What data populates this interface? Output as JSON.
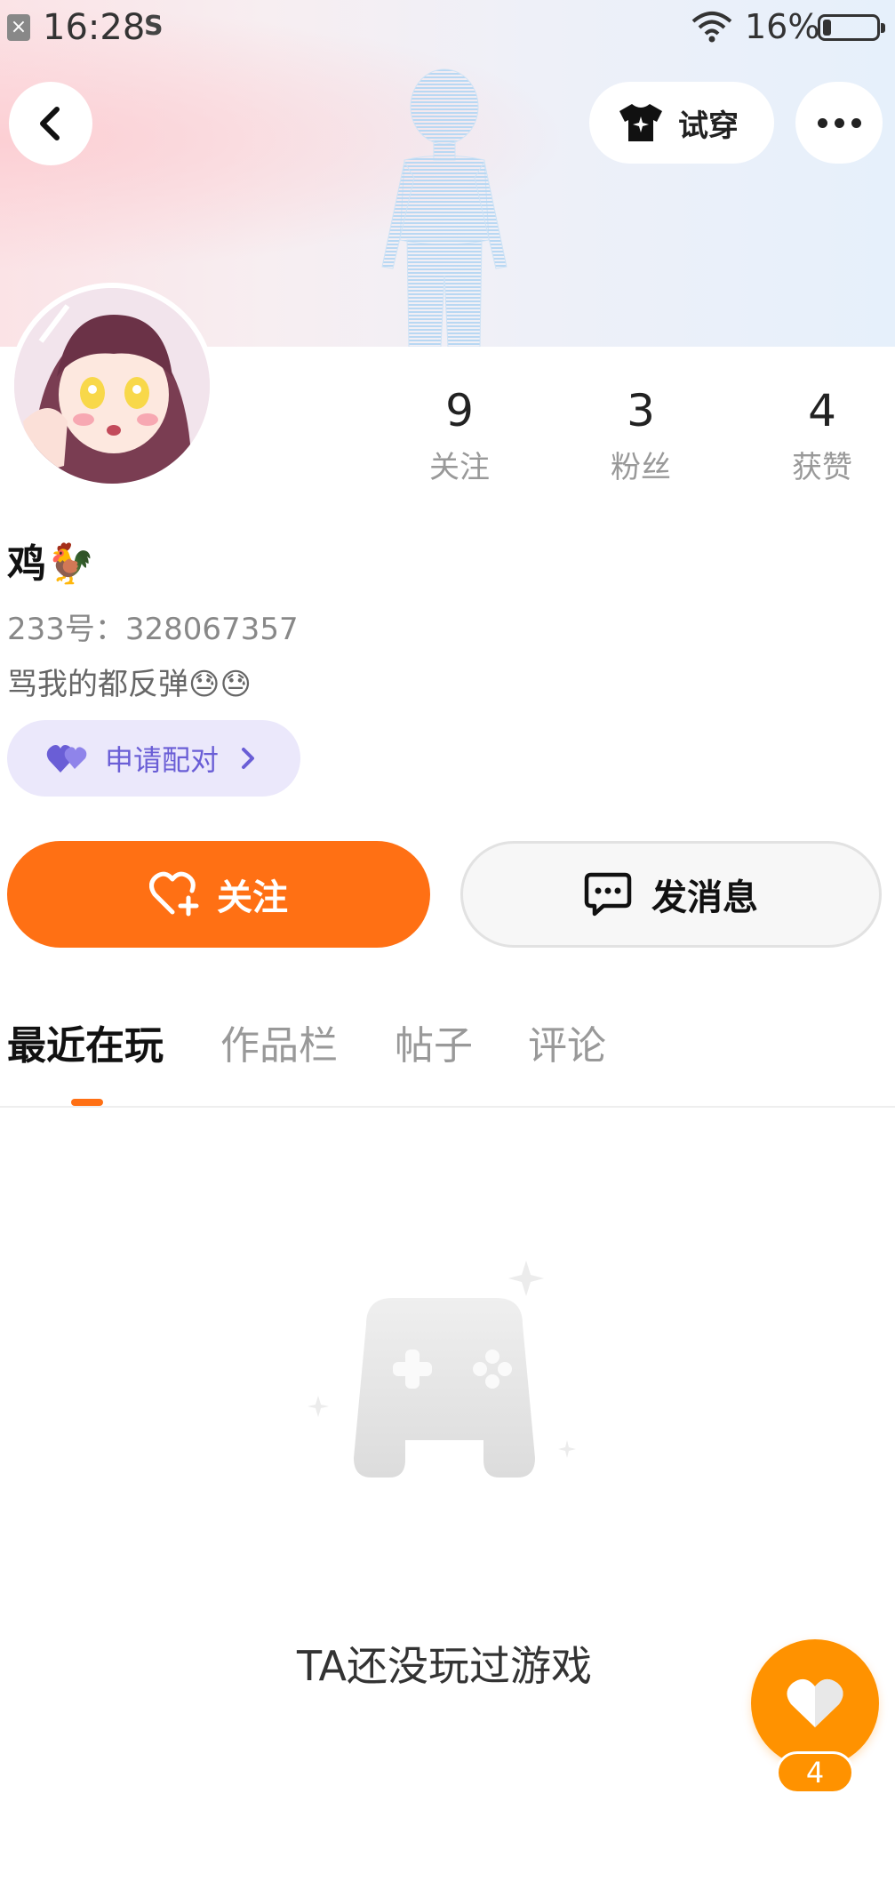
{
  "status_bar": {
    "time": "16:28",
    "sim_icon": "S",
    "battery_percent": "16%",
    "battery_level": 0.16
  },
  "top_actions": {
    "tryon_label": "试穿"
  },
  "stats": [
    {
      "value": "9",
      "label": "关注"
    },
    {
      "value": "3",
      "label": "粉丝"
    },
    {
      "value": "4",
      "label": "获赞"
    }
  ],
  "profile": {
    "name": "鸡🐓",
    "uid": "233号：328067357",
    "bio": "骂我的都反弹😓😓",
    "pair_label": "申请配对"
  },
  "actions": {
    "follow_label": "关注",
    "message_label": "发消息"
  },
  "tabs": [
    {
      "label": "最近在玩",
      "active": true
    },
    {
      "label": "作品栏",
      "active": false
    },
    {
      "label": "帖子",
      "active": false
    },
    {
      "label": "评论",
      "active": false
    }
  ],
  "empty_state": {
    "text": "TA还没玩过游戏"
  },
  "like_fab": {
    "count": "4"
  },
  "colors": {
    "accent": "#ff7014",
    "fab": "#ff9200",
    "pair": "#6a5ed6"
  }
}
